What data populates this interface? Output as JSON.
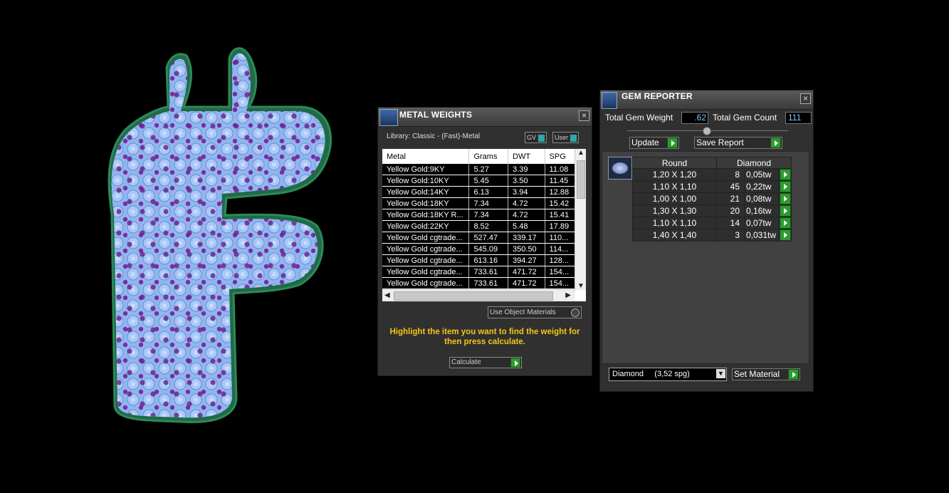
{
  "viewport": {
    "model": "letter-f-pave-set"
  },
  "metal_weights": {
    "title": "METAL WEIGHTS",
    "library_label": "Library: Classic - (Fast)-Metal",
    "toggle_gv": "GV",
    "toggle_user": "User",
    "columns": [
      "Metal",
      "Grams",
      "DWT",
      "SPG"
    ],
    "rows": [
      [
        "Yellow Gold:9KY",
        "5.27",
        "3.39",
        "11.08"
      ],
      [
        "Yellow Gold:10KY",
        "5.45",
        "3.50",
        "11.45"
      ],
      [
        "Yellow Gold:14KY",
        "6.13",
        "3.94",
        "12.88"
      ],
      [
        "Yellow Gold:18KY",
        "7.34",
        "4.72",
        "15.42"
      ],
      [
        "Yellow Gold:18KY R...",
        "7.34",
        "4.72",
        "15.41"
      ],
      [
        "Yellow Gold:22KY",
        "8.52",
        "5.48",
        "17.89"
      ],
      [
        "Yellow Gold cgtrade...",
        "527.47",
        "339.17",
        "110..."
      ],
      [
        "Yellow Gold cgtrade...",
        "545.09",
        "350.50",
        "114..."
      ],
      [
        "Yellow Gold cgtrade...",
        "613.16",
        "394.27",
        "128..."
      ],
      [
        "Yellow Gold cgtrade...",
        "733.61",
        "471.72",
        "154..."
      ],
      [
        "Yellow Gold cgtrade...",
        "733.61",
        "471.72",
        "154..."
      ]
    ],
    "use_object_materials": "Use Object Materials",
    "hint": "Highlight the item you want to find the weight for then press calculate.",
    "calculate_label": "Calculate"
  },
  "gem_reporter": {
    "title": "GEM REPORTER",
    "total_weight_label": "Total Gem Weight",
    "total_weight_value": ".62",
    "total_count_label": "Total Gem Count",
    "total_count_value": "111",
    "update_label": "Update",
    "save_report_label": "Save Report",
    "shape_header": "Round",
    "material_header": "Diamond",
    "rows": [
      [
        "1,20 X 1,20",
        "8",
        "0,05tw"
      ],
      [
        "1,10 X 1,10",
        "45",
        "0,22tw"
      ],
      [
        "1,00 X 1,00",
        "21",
        "0,08tw"
      ],
      [
        "1,30 X 1,30",
        "20",
        "0,16tw"
      ],
      [
        "1,10 X 1,10",
        "14",
        "0,07tw"
      ],
      [
        "1,40 X 1,40",
        "3",
        "0,031tw"
      ]
    ],
    "material_select": "Diamond     (3,52 spg)",
    "set_material_label": "Set Material"
  },
  "colors": {
    "hint": "#f5c518",
    "accent_green": "#2e9b2e",
    "gem_blue": "#8fb4ee",
    "gem_purple": "#7a2ea0",
    "metal_green": "#1f6b45"
  }
}
